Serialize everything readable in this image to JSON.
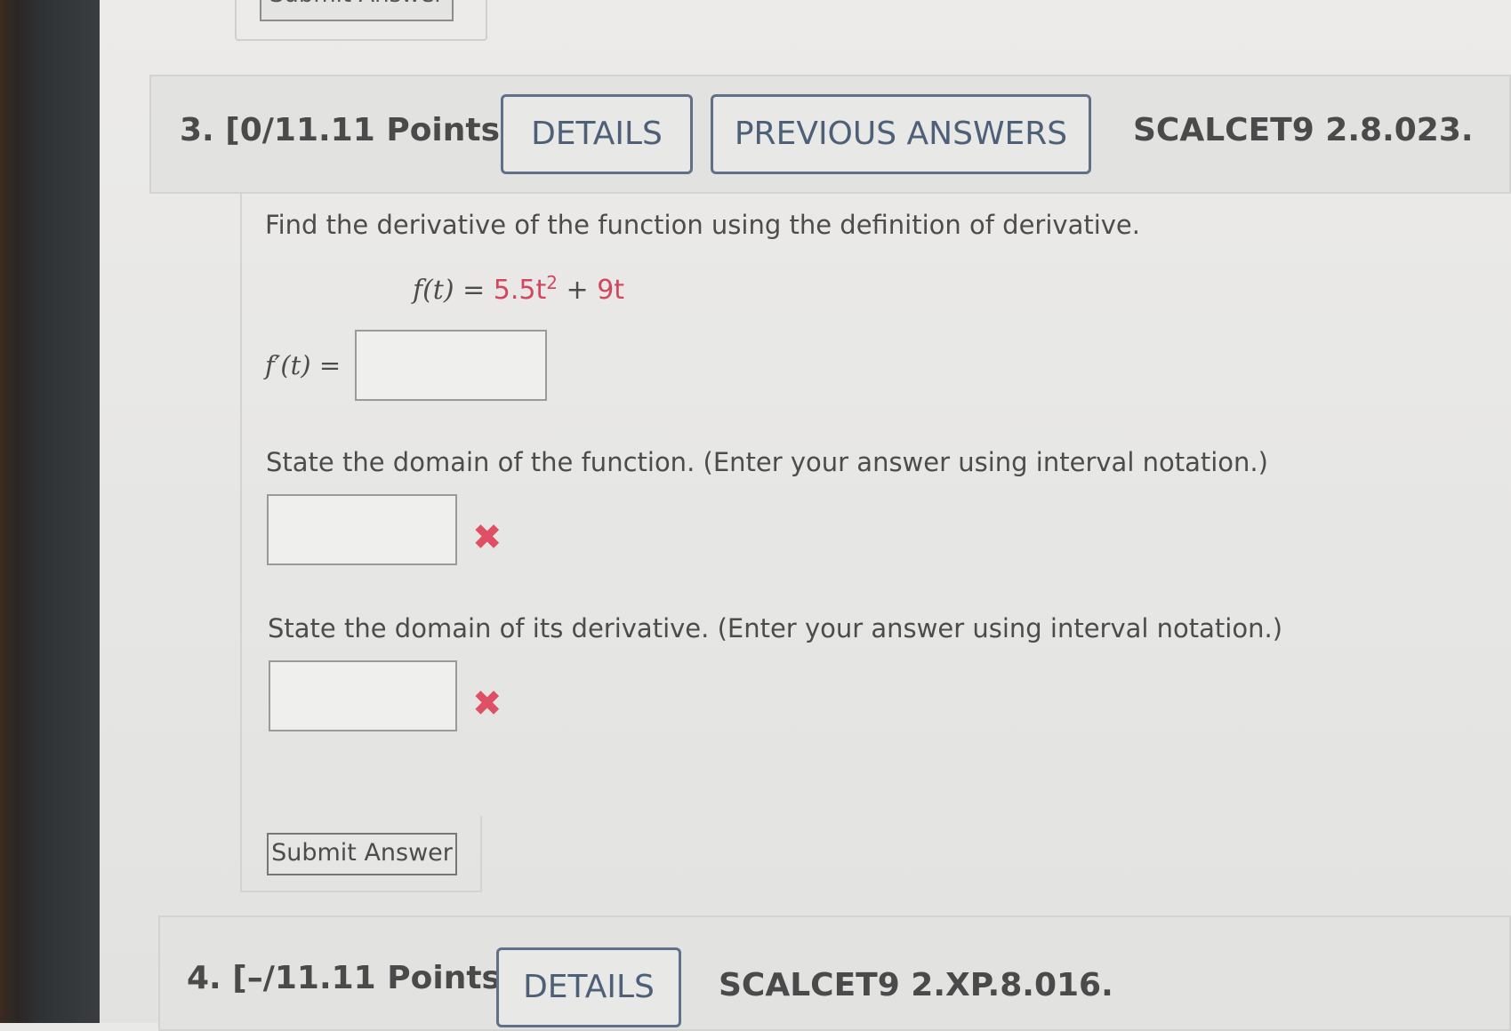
{
  "previous_question": {
    "submit_label": "Submit Answer"
  },
  "question3": {
    "number_points": "3.  [0/11.11 Points]",
    "details_label": "DETAILS",
    "previous_answers_label": "PREVIOUS ANSWERS",
    "code": "SCALCET9 2.8.023.",
    "prompt": "Find the derivative of the function using the definition of derivative.",
    "function_lhs": "f(t) = ",
    "function_coef": "5.5t",
    "function_exp": "2",
    "function_plus": " + ",
    "function_term": "9t",
    "derivative_label": "f′(t) = ",
    "derivative_value": "",
    "domain_prompt": "State the domain of the function. (Enter your answer using interval notation.)",
    "domain_value": "",
    "domain_deriv_prompt": "State the domain of its derivative. (Enter your answer using interval notation.)",
    "domain_deriv_value": "",
    "wrong_mark": "✖",
    "submit_label": "Submit Answer",
    "colors": {
      "function_value": "#d2465e",
      "wrong_mark": "#e05064",
      "button_border": "#5f7088"
    }
  },
  "question4": {
    "number_points": "4.  [–/11.11 Points]",
    "details_label": "DETAILS",
    "code": "SCALCET9 2.XP.8.016."
  }
}
